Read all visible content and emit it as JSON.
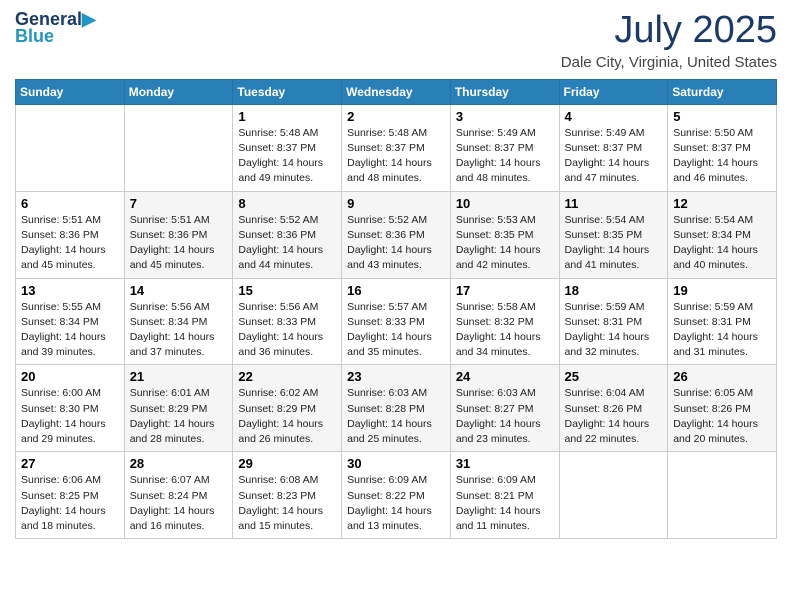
{
  "header": {
    "logo_line1": "General",
    "logo_line2": "Blue",
    "month": "July 2025",
    "location": "Dale City, Virginia, United States"
  },
  "days_of_week": [
    "Sunday",
    "Monday",
    "Tuesday",
    "Wednesday",
    "Thursday",
    "Friday",
    "Saturday"
  ],
  "weeks": [
    [
      {
        "day": "",
        "info": ""
      },
      {
        "day": "",
        "info": ""
      },
      {
        "day": "1",
        "info": "Sunrise: 5:48 AM\nSunset: 8:37 PM\nDaylight: 14 hours and 49 minutes."
      },
      {
        "day": "2",
        "info": "Sunrise: 5:48 AM\nSunset: 8:37 PM\nDaylight: 14 hours and 48 minutes."
      },
      {
        "day": "3",
        "info": "Sunrise: 5:49 AM\nSunset: 8:37 PM\nDaylight: 14 hours and 48 minutes."
      },
      {
        "day": "4",
        "info": "Sunrise: 5:49 AM\nSunset: 8:37 PM\nDaylight: 14 hours and 47 minutes."
      },
      {
        "day": "5",
        "info": "Sunrise: 5:50 AM\nSunset: 8:37 PM\nDaylight: 14 hours and 46 minutes."
      }
    ],
    [
      {
        "day": "6",
        "info": "Sunrise: 5:51 AM\nSunset: 8:36 PM\nDaylight: 14 hours and 45 minutes."
      },
      {
        "day": "7",
        "info": "Sunrise: 5:51 AM\nSunset: 8:36 PM\nDaylight: 14 hours and 45 minutes."
      },
      {
        "day": "8",
        "info": "Sunrise: 5:52 AM\nSunset: 8:36 PM\nDaylight: 14 hours and 44 minutes."
      },
      {
        "day": "9",
        "info": "Sunrise: 5:52 AM\nSunset: 8:36 PM\nDaylight: 14 hours and 43 minutes."
      },
      {
        "day": "10",
        "info": "Sunrise: 5:53 AM\nSunset: 8:35 PM\nDaylight: 14 hours and 42 minutes."
      },
      {
        "day": "11",
        "info": "Sunrise: 5:54 AM\nSunset: 8:35 PM\nDaylight: 14 hours and 41 minutes."
      },
      {
        "day": "12",
        "info": "Sunrise: 5:54 AM\nSunset: 8:34 PM\nDaylight: 14 hours and 40 minutes."
      }
    ],
    [
      {
        "day": "13",
        "info": "Sunrise: 5:55 AM\nSunset: 8:34 PM\nDaylight: 14 hours and 39 minutes."
      },
      {
        "day": "14",
        "info": "Sunrise: 5:56 AM\nSunset: 8:34 PM\nDaylight: 14 hours and 37 minutes."
      },
      {
        "day": "15",
        "info": "Sunrise: 5:56 AM\nSunset: 8:33 PM\nDaylight: 14 hours and 36 minutes."
      },
      {
        "day": "16",
        "info": "Sunrise: 5:57 AM\nSunset: 8:33 PM\nDaylight: 14 hours and 35 minutes."
      },
      {
        "day": "17",
        "info": "Sunrise: 5:58 AM\nSunset: 8:32 PM\nDaylight: 14 hours and 34 minutes."
      },
      {
        "day": "18",
        "info": "Sunrise: 5:59 AM\nSunset: 8:31 PM\nDaylight: 14 hours and 32 minutes."
      },
      {
        "day": "19",
        "info": "Sunrise: 5:59 AM\nSunset: 8:31 PM\nDaylight: 14 hours and 31 minutes."
      }
    ],
    [
      {
        "day": "20",
        "info": "Sunrise: 6:00 AM\nSunset: 8:30 PM\nDaylight: 14 hours and 29 minutes."
      },
      {
        "day": "21",
        "info": "Sunrise: 6:01 AM\nSunset: 8:29 PM\nDaylight: 14 hours and 28 minutes."
      },
      {
        "day": "22",
        "info": "Sunrise: 6:02 AM\nSunset: 8:29 PM\nDaylight: 14 hours and 26 minutes."
      },
      {
        "day": "23",
        "info": "Sunrise: 6:03 AM\nSunset: 8:28 PM\nDaylight: 14 hours and 25 minutes."
      },
      {
        "day": "24",
        "info": "Sunrise: 6:03 AM\nSunset: 8:27 PM\nDaylight: 14 hours and 23 minutes."
      },
      {
        "day": "25",
        "info": "Sunrise: 6:04 AM\nSunset: 8:26 PM\nDaylight: 14 hours and 22 minutes."
      },
      {
        "day": "26",
        "info": "Sunrise: 6:05 AM\nSunset: 8:26 PM\nDaylight: 14 hours and 20 minutes."
      }
    ],
    [
      {
        "day": "27",
        "info": "Sunrise: 6:06 AM\nSunset: 8:25 PM\nDaylight: 14 hours and 18 minutes."
      },
      {
        "day": "28",
        "info": "Sunrise: 6:07 AM\nSunset: 8:24 PM\nDaylight: 14 hours and 16 minutes."
      },
      {
        "day": "29",
        "info": "Sunrise: 6:08 AM\nSunset: 8:23 PM\nDaylight: 14 hours and 15 minutes."
      },
      {
        "day": "30",
        "info": "Sunrise: 6:09 AM\nSunset: 8:22 PM\nDaylight: 14 hours and 13 minutes."
      },
      {
        "day": "31",
        "info": "Sunrise: 6:09 AM\nSunset: 8:21 PM\nDaylight: 14 hours and 11 minutes."
      },
      {
        "day": "",
        "info": ""
      },
      {
        "day": "",
        "info": ""
      }
    ]
  ]
}
